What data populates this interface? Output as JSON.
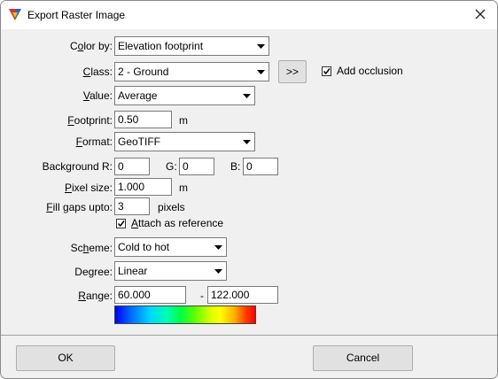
{
  "window": {
    "title": "Export Raster Image",
    "app_icon": "triangle-palette-icon",
    "close_icon": "close-icon"
  },
  "form": {
    "color_by": {
      "label_pre": "C",
      "label_u": "o",
      "label_post": "lor by:",
      "value": "Elevation footprint"
    },
    "class": {
      "label_pre": "",
      "label_u": "C",
      "label_post": "lass:",
      "value": "2 - Ground",
      "more_button": ">>"
    },
    "add_occlusion": {
      "label": "Add occlusion",
      "checked": true
    },
    "value": {
      "label_pre": "",
      "label_u": "V",
      "label_post": "alue:",
      "value": "Average"
    },
    "footprint": {
      "label_pre": "",
      "label_u": "F",
      "label_post": "ootprint:",
      "value": "0.50",
      "unit": "m"
    },
    "format": {
      "label_pre": "",
      "label_u": "F",
      "label_post": "ormat:",
      "value": "GeoTIFF"
    },
    "background": {
      "label_r": "Background R:",
      "r": "0",
      "label_g": "G:",
      "g": "0",
      "label_b": "B:",
      "b": "0"
    },
    "pixel_size": {
      "label_pre": "",
      "label_u": "P",
      "label_post": "ixel size:",
      "value": "1.000",
      "unit": "m"
    },
    "fill_gaps": {
      "label_pre": "",
      "label_u": "F",
      "label_post": "ill gaps upto:",
      "value": "3",
      "unit": "pixels"
    },
    "attach": {
      "label_pre": "",
      "label_u": "A",
      "label_post": "ttach as reference",
      "checked": true
    },
    "scheme": {
      "label_pre": "Sc",
      "label_u": "h",
      "label_post": "eme:",
      "value": "Cold to hot"
    },
    "degree": {
      "label": "Degree:",
      "value": "Linear"
    },
    "range": {
      "label_pre": "",
      "label_u": "R",
      "label_post": "ange:",
      "min": "60.000",
      "dash": "-",
      "max": "122.000"
    },
    "colors": {
      "gradient_start": "#0000ff",
      "gradient_end": "#ff0000"
    }
  },
  "buttons": {
    "ok": "OK",
    "cancel": "Cancel"
  }
}
